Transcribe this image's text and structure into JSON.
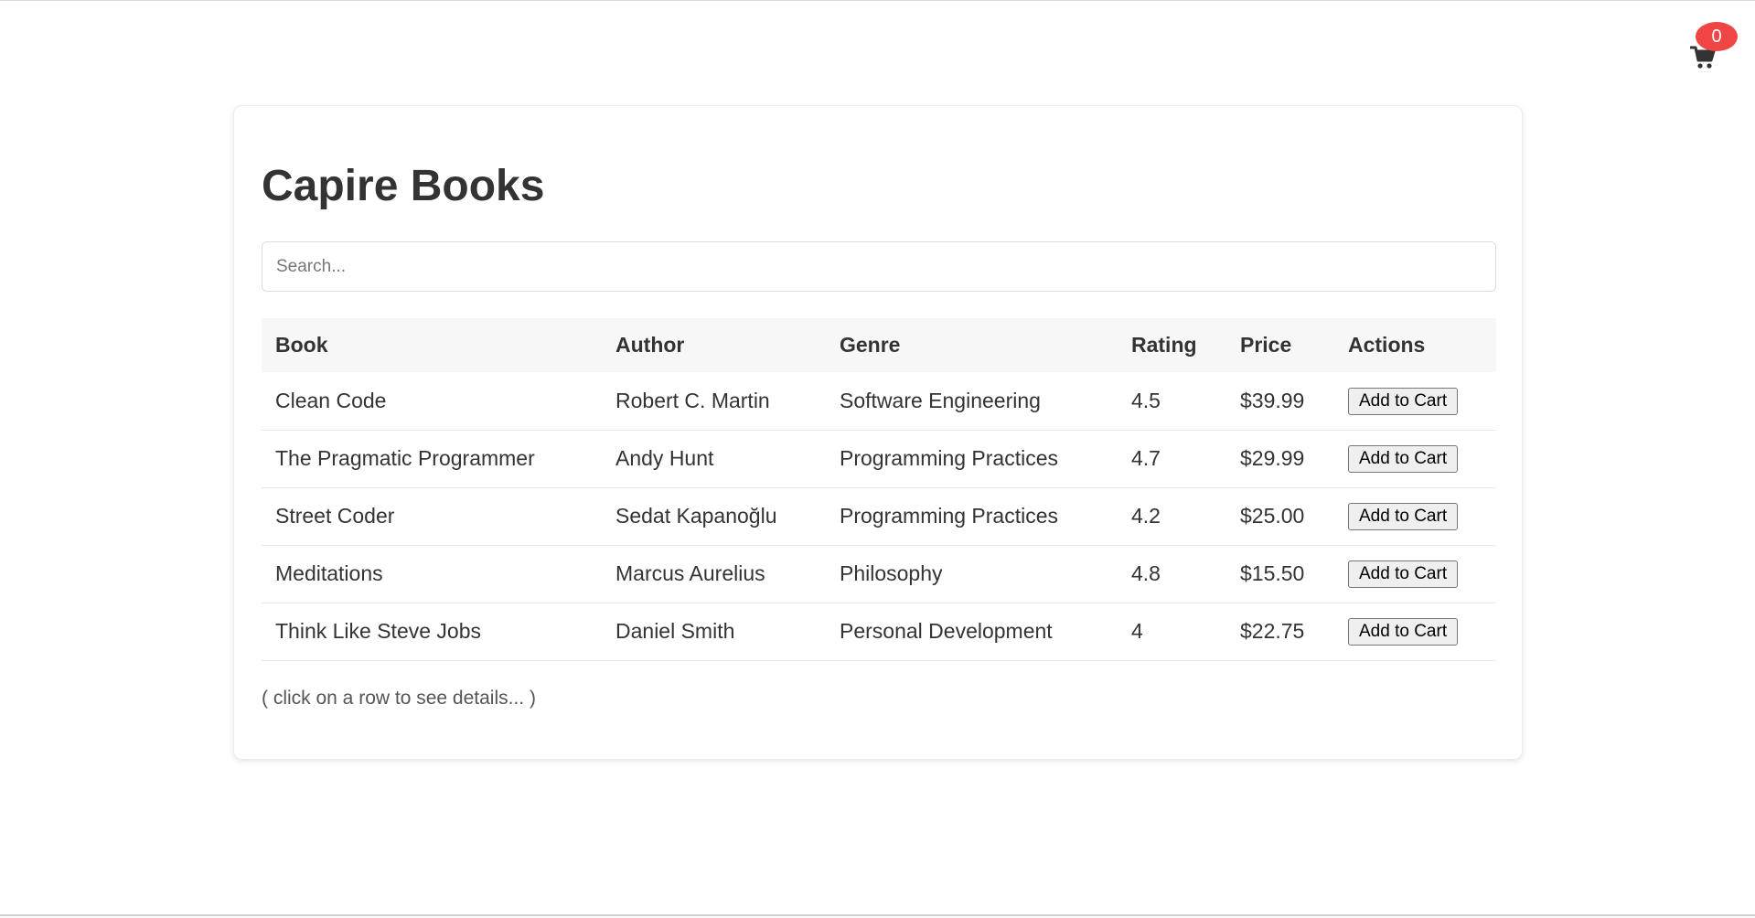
{
  "cart": {
    "icon": "shopping-cart-icon",
    "count": "0",
    "badge_color": "#f04545"
  },
  "header": {
    "title": "Capire Books"
  },
  "search": {
    "placeholder": "Search...",
    "value": ""
  },
  "table": {
    "columns": [
      "Book",
      "Author",
      "Genre",
      "Rating",
      "Price",
      "Actions"
    ],
    "rows": [
      {
        "book": "Clean Code",
        "author": "Robert C. Martin",
        "genre": "Software Engineering",
        "rating": "4.5",
        "price": "$39.99",
        "action": "Add to Cart"
      },
      {
        "book": "The Pragmatic Programmer",
        "author": "Andy Hunt",
        "genre": "Programming Practices",
        "rating": "4.7",
        "price": "$29.99",
        "action": "Add to Cart"
      },
      {
        "book": "Street Coder",
        "author": "Sedat Kapanoğlu",
        "genre": "Programming Practices",
        "rating": "4.2",
        "price": "$25.00",
        "action": "Add to Cart"
      },
      {
        "book": "Meditations",
        "author": "Marcus Aurelius",
        "genre": "Philosophy",
        "rating": "4.8",
        "price": "$15.50",
        "action": "Add to Cart"
      },
      {
        "book": "Think Like Steve Jobs",
        "author": "Daniel Smith",
        "genre": "Personal Development",
        "rating": "4",
        "price": "$22.75",
        "action": "Add to Cart"
      }
    ]
  },
  "footer": {
    "hint": "( click on a row to see details... )"
  }
}
